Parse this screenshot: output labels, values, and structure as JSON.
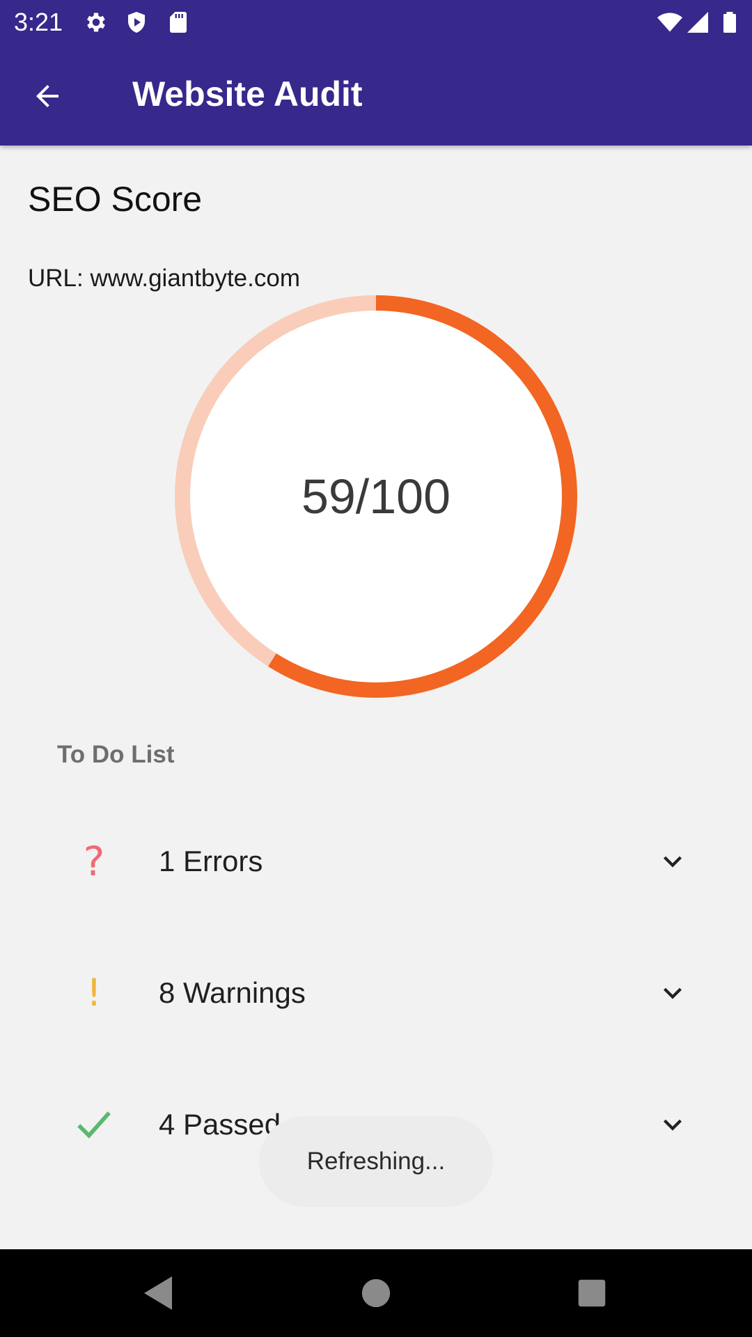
{
  "status_bar": {
    "time": "3:21",
    "left_icons": [
      "settings-icon",
      "shield-icon",
      "sd-card-icon"
    ],
    "right_icons": [
      "wifi-icon",
      "signal-icon",
      "battery-icon"
    ]
  },
  "app_bar": {
    "title": "Website Audit",
    "back_icon": "arrow-back-icon"
  },
  "main": {
    "section_title": "SEO Score",
    "url": "URL: www.giantbyte.com",
    "score": {
      "text": "59/100",
      "value": 59,
      "max": 100,
      "progress_color": "#f26522",
      "track_color": "#f9cdb9"
    },
    "todo_title": "To Do List",
    "items": [
      {
        "label": "1 Errors",
        "icon": "question-icon",
        "color": "#ef6b73"
      },
      {
        "label": "8 Warnings",
        "icon": "exclamation-icon",
        "color": "#f1b43a"
      },
      {
        "label": "4 Passed",
        "icon": "check-icon",
        "color": "#5cb86e"
      }
    ]
  },
  "toast": {
    "text": "Refreshing..."
  },
  "colors": {
    "primary": "#37288c",
    "background": "#f2f2f2"
  }
}
